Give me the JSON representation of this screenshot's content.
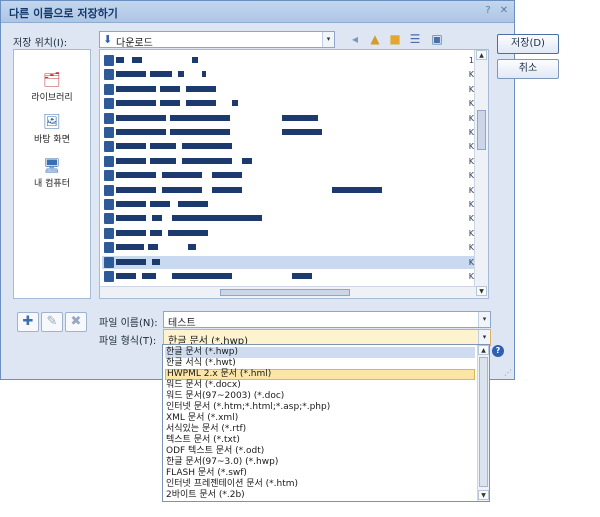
{
  "window": {
    "title": "다른 이름으로 저장하기",
    "help_glyph": "?",
    "close_glyph": "✕"
  },
  "location": {
    "label": "저장 위치(I):",
    "value": "다운로드",
    "arrow": "▾"
  },
  "places": [
    {
      "label": "라이브러리",
      "icon": "library-icon",
      "glyph": "🗂"
    },
    {
      "label": "바탕 화면",
      "icon": "desktop-icon",
      "glyph": "🖼"
    },
    {
      "label": "내 컴퓨터",
      "icon": "computer-icon",
      "glyph": "🖥"
    }
  ],
  "toolbar_icons": [
    "back-arrow-icon",
    "up-folder-icon",
    "new-folder-icon",
    "view-menu-icon",
    "bookmark-icon"
  ],
  "filename": {
    "label": "파일 이름(N):",
    "value": "테스트"
  },
  "filetype": {
    "label": "파일 형식(T):",
    "value": "한글 문서 (*.hwp)",
    "options": [
      "한글 문서 (*.hwp)",
      "한글 서식 (*.hwt)",
      "HWPML 2.x 문서 (*.hml)",
      "워드 문서 (*.docx)",
      "워드 문서(97~2003) (*.doc)",
      "인터넷 문서 (*.htm;*.html;*.asp;*.php)",
      "XML 문서 (*.xml)",
      "서식있는 문서 (*.rtf)",
      "텍스트 문서 (*.txt)",
      "ODF 텍스트 문서 (*.odt)",
      "한글 문서(97~3.0) (*.hwp)",
      "FLASH 문서 (*.swf)",
      "인터넷 프레젠테이션 문서 (*.htm)",
      "2바이트 문서 (*.2b)"
    ],
    "highlighted_index": 2
  },
  "buttons": {
    "save": "저장(D)",
    "cancel": "취소"
  },
  "file_rows": [
    {
      "tail": "1"
    },
    {
      "tail": "K"
    },
    {
      "tail": "K"
    },
    {
      "tail": "K"
    },
    {
      "tail": "K"
    },
    {
      "tail": "K"
    },
    {
      "tail": "K"
    },
    {
      "tail": "K"
    },
    {
      "tail": "K"
    },
    {
      "tail": "K"
    },
    {
      "tail": "K"
    },
    {
      "tail": "K"
    },
    {
      "tail": "K"
    },
    {
      "tail": "K"
    },
    {
      "tail": "K"
    },
    {
      "tail": "K"
    }
  ],
  "colors": {
    "accent": "#2f5fb0",
    "highlight": "#fbe6a8"
  }
}
